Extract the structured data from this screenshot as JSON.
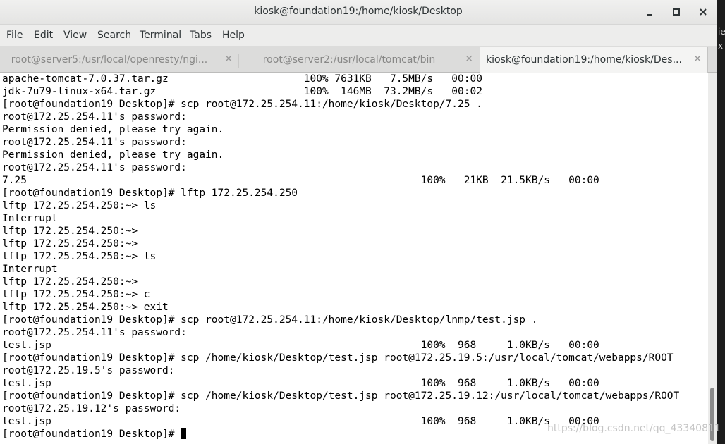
{
  "window": {
    "title": "kiosk@foundation19:/home/kiosk/Desktop",
    "minimize_glyph": "✕",
    "maximize_glyph": "▢",
    "close_glyph": "✕"
  },
  "menu": [
    "File",
    "Edit",
    "View",
    "Search",
    "Terminal",
    "Tabs",
    "Help"
  ],
  "tabs": [
    {
      "label": "root@server5:/usr/local/openresty/ngi...",
      "close": "✕",
      "active": false
    },
    {
      "label": "root@server2:/usr/local/tomcat/bin",
      "close": "✕",
      "active": false
    },
    {
      "label": "kiosk@foundation19:/home/kiosk/Des...",
      "close": "✕",
      "active": true
    }
  ],
  "terminal": {
    "lines": [
      "apache-tomcat-7.0.37.tar.gz                      100% 7631KB   7.5MB/s   00:00",
      "jdk-7u79-linux-x64.tar.gz                        100%  146MB  73.2MB/s   00:02",
      "[root@foundation19 Desktop]# scp root@172.25.254.11:/home/kiosk/Desktop/7.25 .",
      "root@172.25.254.11's password:",
      "Permission denied, please try again.",
      "root@172.25.254.11's password:",
      "Permission denied, please try again.",
      "root@172.25.254.11's password:",
      "7.25                                                                100%   21KB  21.5KB/s   00:00",
      "[root@foundation19 Desktop]# lftp 172.25.254.250",
      "lftp 172.25.254.250:~> ls",
      "Interrupt",
      "lftp 172.25.254.250:~>",
      "lftp 172.25.254.250:~>",
      "lftp 172.25.254.250:~> ls",
      "Interrupt",
      "lftp 172.25.254.250:~>",
      "lftp 172.25.254.250:~> c",
      "lftp 172.25.254.250:~> exit",
      "[root@foundation19 Desktop]# scp root@172.25.254.11:/home/kiosk/Desktop/lnmp/test.jsp .",
      "root@172.25.254.11's password:",
      "test.jsp                                                            100%  968     1.0KB/s   00:00",
      "[root@foundation19 Desktop]# scp /home/kiosk/Desktop/test.jsp root@172.25.19.5:/usr/local/tomcat/webapps/ROOT",
      "root@172.25.19.5's password:",
      "test.jsp                                                            100%  968     1.0KB/s   00:00",
      "[root@foundation19 Desktop]# scp /home/kiosk/Desktop/test.jsp root@172.25.19.12:/usr/local/tomcat/webapps/ROOT",
      "root@172.25.19.12's password:",
      "test.jsp                                                            100%  968     1.0KB/s   00:00",
      "[root@foundation19 Desktop]# "
    ]
  },
  "side_text": [
    "iec",
    "x"
  ],
  "watermark": "https://blog.csdn.net/qq_43340811"
}
